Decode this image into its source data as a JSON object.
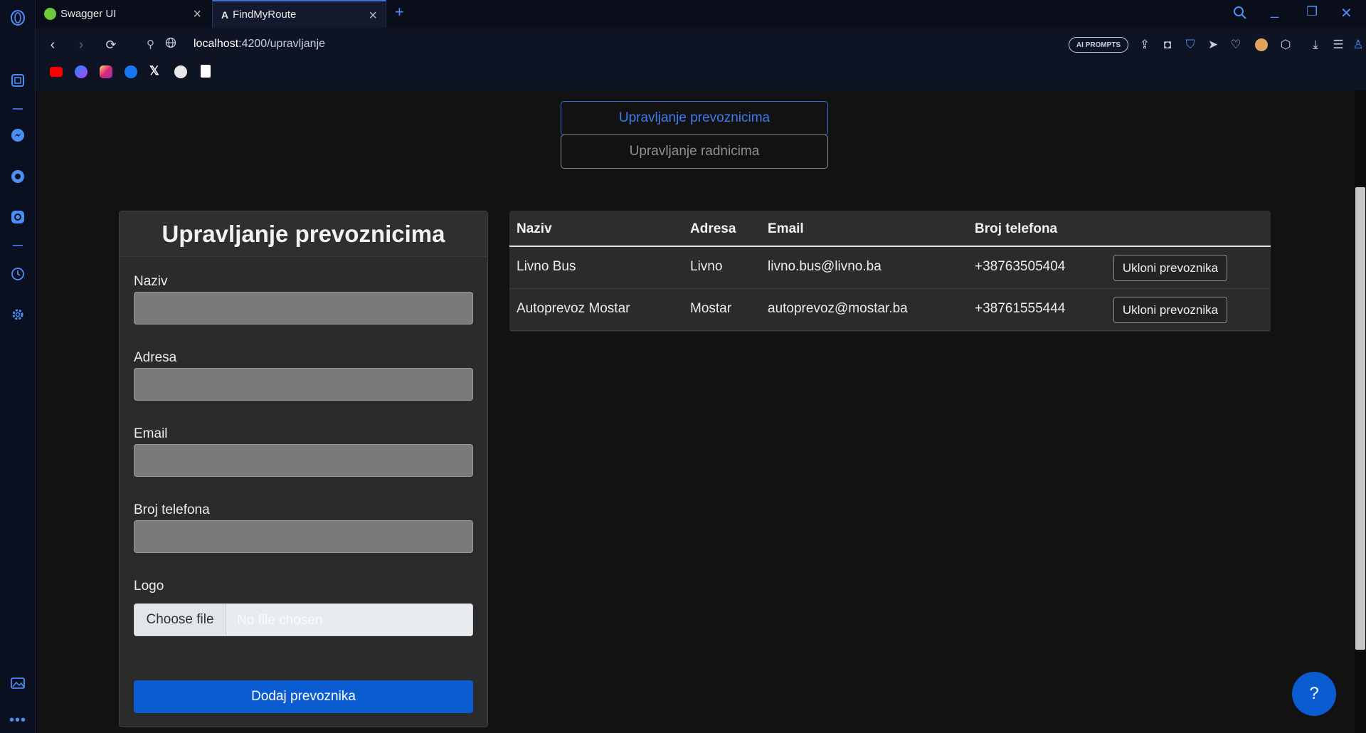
{
  "browser": {
    "tabs": [
      {
        "title": "Swagger UI",
        "icon": "swagger-icon"
      },
      {
        "title": "FindMyRoute",
        "icon": "angular-icon"
      }
    ],
    "new_tab": "+",
    "url_host": "localhost",
    "url_path": ":4200/upravljanje",
    "ai_prompts": "AI PROMPTS",
    "bookmarks": [
      "youtube-icon",
      "messenger-icon",
      "instagram-icon",
      "facebook-icon",
      "x-icon",
      "chatgpt-icon",
      "document-icon"
    ],
    "window_controls": {
      "minimize": "_",
      "restore": "❐",
      "close": "✕"
    },
    "accent": "#3d6fd9"
  },
  "nav": {
    "carriers_label": "Upravljanje prevoznicima",
    "workers_label": "Upravljanje radnicima"
  },
  "form": {
    "title": "Upravljanje prevoznicima",
    "name_label": "Naziv",
    "name_value": "",
    "address_label": "Adresa",
    "address_value": "",
    "email_label": "Email",
    "email_value": "",
    "phone_label": "Broj telefona",
    "phone_value": "",
    "logo_label": "Logo",
    "choose_file": "Choose file",
    "no_file": "No file chosen",
    "submit": "Dodaj prevoznika",
    "submit_color": "#0b5cd0"
  },
  "table": {
    "headers": [
      "Naziv",
      "Adresa",
      "Email",
      "Broj telefona"
    ],
    "rows": [
      {
        "name": "Livno Bus",
        "address": "Livno",
        "email": "livno.bus@livno.ba",
        "phone": "+38763505404",
        "action": "Ukloni prevoznika"
      },
      {
        "name": "Autoprevoz Mostar",
        "address": "Mostar",
        "email": "autoprevoz@mostar.ba",
        "phone": "+38761555444",
        "action": "Ukloni prevoznika"
      }
    ]
  },
  "help": {
    "label": "?"
  }
}
